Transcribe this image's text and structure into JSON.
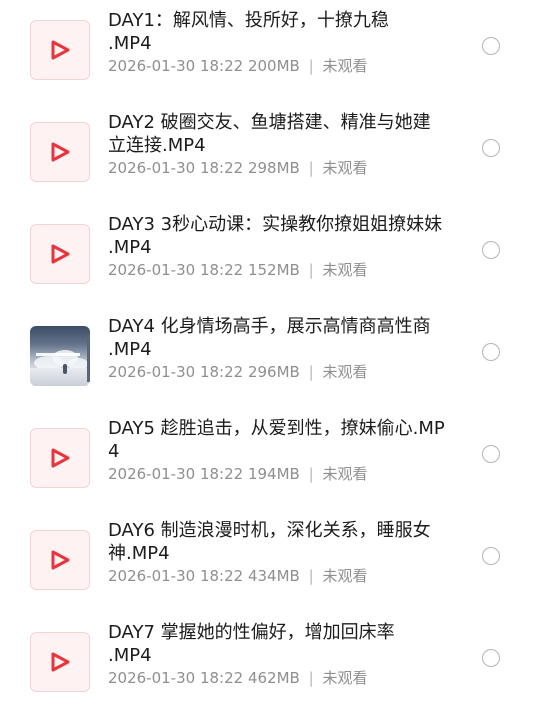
{
  "files": [
    {
      "title": "DAY1：解风情、投所好，十撩九稳\n.MP4",
      "date": "2026-01-30 18:22",
      "size": "200MB",
      "status": "未观看",
      "thumbnail": "video-icon"
    },
    {
      "title": "DAY2 破圈交友、鱼塘搭建、精准与她建立连接.MP4",
      "date": "2026-01-30 18:22",
      "size": "298MB",
      "status": "未观看",
      "thumbnail": "video-icon"
    },
    {
      "title": "DAY3 3秒心动课：实操教你撩姐姐撩妹妹 .MP4",
      "date": "2026-01-30 18:22",
      "size": "152MB",
      "status": "未观看",
      "thumbnail": "video-icon"
    },
    {
      "title": "DAY4 化身情场高手，展示高情商高性商    .MP4",
      "date": "2026-01-30 18:22",
      "size": "296MB",
      "status": "未观看",
      "thumbnail": "video-preview"
    },
    {
      "title": "DAY5 趁胜追击，从爱到性，撩妹偷心.MP4",
      "date": "2026-01-30 18:22",
      "size": "194MB",
      "status": "未观看",
      "thumbnail": "video-icon"
    },
    {
      "title": "DAY6 制造浪漫时机，深化关系，睡服女神.MP4",
      "date": "2026-01-30 18:22",
      "size": "434MB",
      "status": "未观看",
      "thumbnail": "video-icon"
    },
    {
      "title": "DAY7 掌握她的性偏好，增加回床率\n.MP4",
      "date": "2026-01-30 18:22",
      "size": "462MB",
      "status": "未观看",
      "thumbnail": "video-icon"
    }
  ],
  "meta_separator": "|",
  "colors": {
    "play_icon": "#e8343c",
    "thumb_bg": "#fef2f2",
    "title_text": "#1c1c1c",
    "meta_text": "#8f8f8f",
    "radio_border": "#b5b5b5"
  }
}
